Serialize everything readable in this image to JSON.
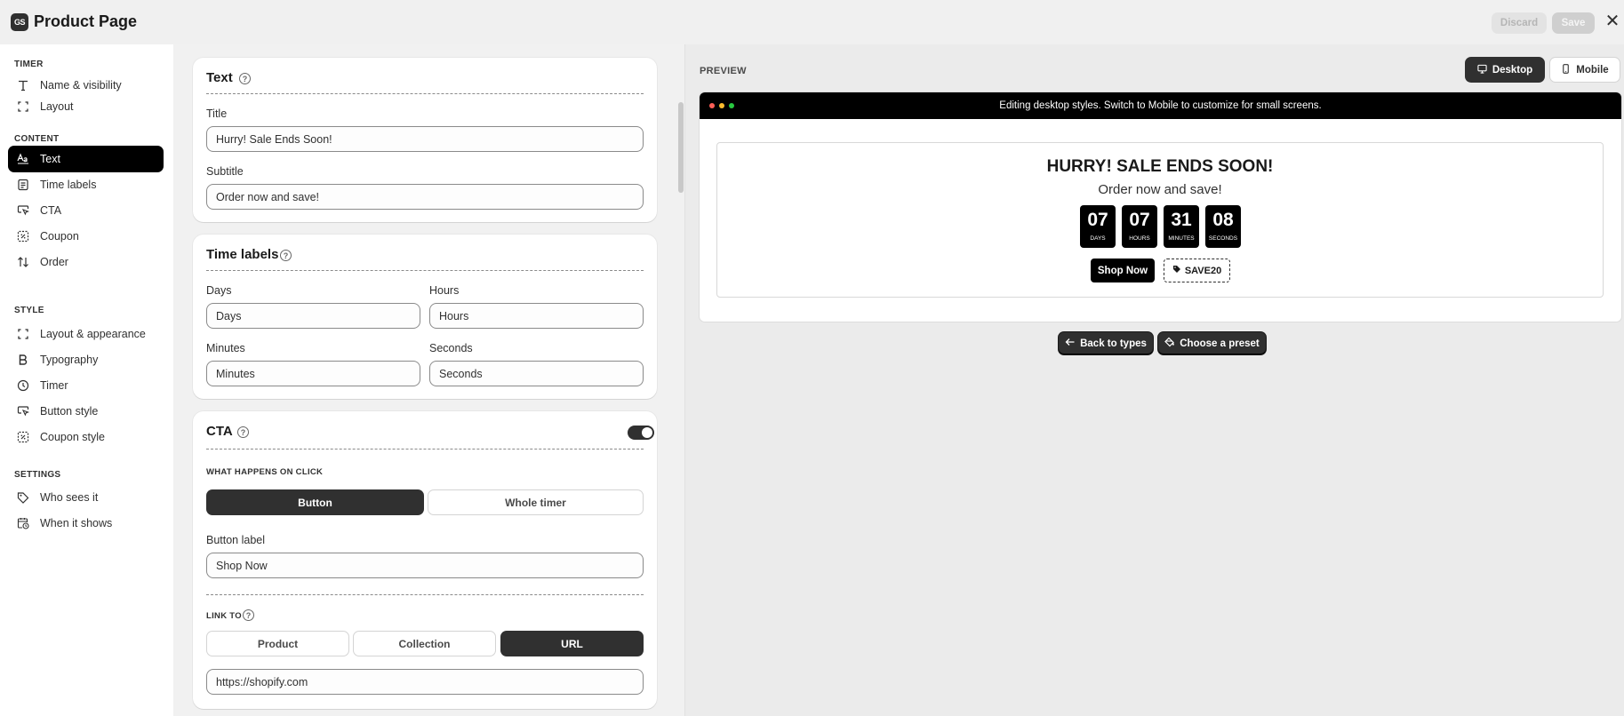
{
  "app": {
    "logo_text": "GS",
    "title": "Product Page",
    "discard_label": "Discard",
    "save_label": "Save",
    "close_glyph": "✕"
  },
  "sidebar": {
    "sections": [
      {
        "title": "TIMER",
        "items": [
          {
            "label": "Name & visibility",
            "icon": "text-t-icon"
          },
          {
            "label": "Layout",
            "icon": "layout-icon"
          }
        ]
      },
      {
        "title": "CONTENT",
        "items": [
          {
            "label": "Text",
            "icon": "text-aa-icon",
            "active": true
          },
          {
            "label": "Time labels",
            "icon": "list-icon"
          },
          {
            "label": "CTA",
            "icon": "cursor-icon"
          },
          {
            "label": "Coupon",
            "icon": "coupon-icon"
          },
          {
            "label": "Order",
            "icon": "sort-icon"
          }
        ]
      },
      {
        "title": "STYLE",
        "items": [
          {
            "label": "Layout & appearance",
            "icon": "layout-icon"
          },
          {
            "label": "Typography",
            "icon": "bold-icon"
          },
          {
            "label": "Timer",
            "icon": "clock-icon"
          },
          {
            "label": "Button style",
            "icon": "cursor-icon"
          },
          {
            "label": "Coupon style",
            "icon": "coupon-icon"
          }
        ]
      },
      {
        "title": "SETTINGS",
        "items": [
          {
            "label": "Who sees it",
            "icon": "tag-icon"
          },
          {
            "label": "When it shows",
            "icon": "calendar-clock-icon"
          }
        ]
      }
    ]
  },
  "text_card": {
    "title": "Text",
    "title_label": "Title",
    "title_value": "Hurry! Sale Ends Soon!",
    "subtitle_label": "Subtitle",
    "subtitle_value": "Order now and save!"
  },
  "time_labels_card": {
    "title": "Time labels",
    "days_label": "Days",
    "days_value": "Days",
    "hours_label": "Hours",
    "hours_value": "Hours",
    "minutes_label": "Minutes",
    "minutes_value": "Minutes",
    "seconds_label": "Seconds",
    "seconds_value": "Seconds"
  },
  "cta_card": {
    "title": "CTA",
    "enabled": true,
    "click_caption": "WHAT HAPPENS ON CLICK",
    "click_options": [
      "Button",
      "Whole timer"
    ],
    "click_selected": "Button",
    "button_label_label": "Button label",
    "button_label_value": "Shop Now",
    "link_caption": "LINK TO",
    "link_options": [
      "Product",
      "Collection",
      "URL"
    ],
    "link_selected": "URL",
    "url_value": "https://shopify.com"
  },
  "preview": {
    "label": "PREVIEW",
    "desktop_label": "Desktop",
    "mobile_label": "Mobile",
    "device_selected": "Desktop",
    "banner_message": "Editing desktop styles. Switch to Mobile to customize for small screens.",
    "timer_title": "HURRY! SALE ENDS SOON!",
    "timer_subtitle": "Order now and save!",
    "countdown": [
      {
        "value": "07",
        "label": "DAYS"
      },
      {
        "value": "07",
        "label": "HOURS"
      },
      {
        "value": "31",
        "label": "MINUTES"
      },
      {
        "value": "08",
        "label": "SECONDS"
      }
    ],
    "cta_label": "Shop Now",
    "coupon_code": "SAVE20",
    "back_label": "Back to types",
    "preset_label": "Choose a preset"
  },
  "colors": {
    "accent": "#303030",
    "black": "#000000",
    "dot_red": "#ff5f57",
    "dot_yellow": "#febc2e",
    "dot_green": "#28c840"
  }
}
